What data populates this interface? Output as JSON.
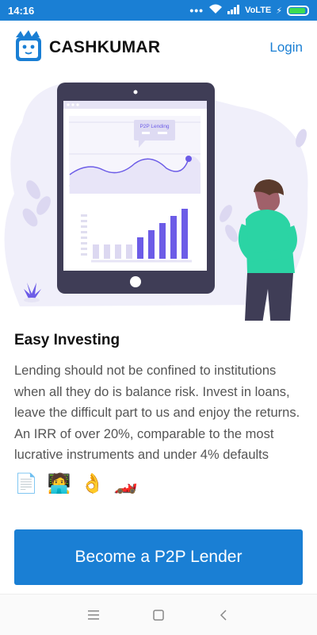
{
  "status_bar": {
    "time": "14:16",
    "network": "VoLTE",
    "battery_level": 0.9
  },
  "header": {
    "app_name": "CASHKUMAR",
    "login_label": "Login",
    "logo_icon": "mascot-face-icon"
  },
  "hero": {
    "tablet_card_label": "P2P Lending",
    "bar_chart_values": [
      2,
      2,
      2,
      2,
      3,
      4,
      5,
      6,
      7
    ],
    "highlighted_from_index": 4
  },
  "content": {
    "title": "Easy Investing",
    "body": "Lending should not be confined to institutions when all they do is balance risk. Invest in loans, leave the difficult part to us and enjoy the returns. An IRR of over 20%, comparable to the most lucrative instruments and under 4% defaults",
    "emojis": [
      "📄",
      "🧑‍💻",
      "👌",
      "🏎️"
    ]
  },
  "cta": {
    "label": "Become a P2P Lender"
  },
  "colors": {
    "primary": "#1a7fd4",
    "accent_purple": "#6c5ce7",
    "battery_green": "#3ddc52"
  },
  "nav_bar": {
    "icons": [
      "menu-icon",
      "home-square-icon",
      "back-icon"
    ]
  }
}
